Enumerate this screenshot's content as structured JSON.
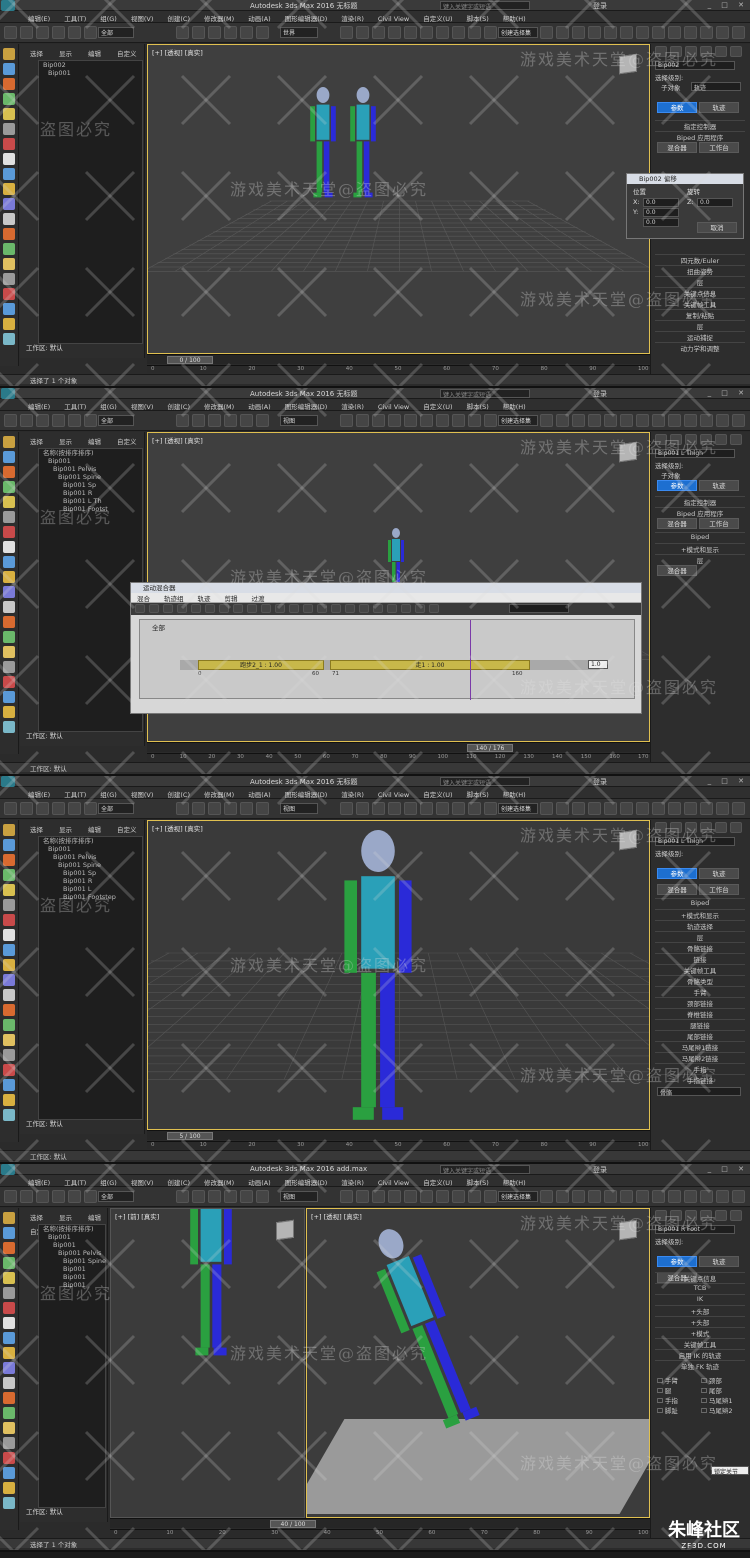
{
  "app": {
    "title": "Autodesk 3ds Max 2016",
    "search_placeholder": "键入关键字或短语",
    "login": "登录",
    "workspace_label": "工作区: 默认"
  },
  "menus": [
    "编辑(E)",
    "工具(T)",
    "组(G)",
    "视图(V)",
    "创建(C)",
    "修改器(M)",
    "动画(A)",
    "图形编辑器(D)",
    "渲染(R)",
    "Civil View",
    "自定义(U)",
    "脚本(S)",
    "帮助(H)"
  ],
  "toolbar": {
    "filter_value": "全部",
    "coord_system_1": "世界",
    "coord_system_2": "视图",
    "named_selection": "创建选择集"
  },
  "scene_explorer": {
    "tabs": [
      "选择",
      "显示",
      "编辑",
      "自定义"
    ],
    "header": "名称(按排序排序)"
  },
  "panels": [
    {
      "file": "无标题",
      "viewport_label": "[+] [透视] [真实]",
      "tree": [
        "Bip002",
        "Bip001"
      ],
      "cmd": {
        "object": "Bip002",
        "sel_level_label": "选择级别:",
        "sub_object_label": "子对象",
        "sub_object_value": "轨迹",
        "tab_params": "参数",
        "tab_track": "轨迹",
        "rollouts": [
          "指定控制器",
          "Biped 应用程序",
          "混合器",
          "工作台"
        ],
        "lower_rollouts": [
          "四元数/Euler",
          "扭曲姿势",
          "层",
          "关键点信息",
          "关键帧工具",
          "复制/粘贴",
          "层",
          "运动捕捉",
          "动力学和调整"
        ]
      },
      "floatwin": {
        "title": "Bip002 偏移",
        "pos_label": "位置",
        "rot_label": "旋转",
        "x_label": "X:",
        "y_label": "Y:",
        "z_label": "Z:",
        "x_val": "0.0",
        "y_val": "0.0",
        "z_val": "0.0",
        "rz_val": "0.0",
        "cancel": "取消"
      },
      "timeline": "0 / 100",
      "status": "选择了 1 个对象",
      "ruler": [
        "0",
        "10",
        "20",
        "30",
        "40",
        "50",
        "60",
        "70",
        "80",
        "90",
        "100"
      ]
    },
    {
      "file": "无标题",
      "viewport_label": "[+] [透视] [真实]",
      "tree": [
        "名称(按排序排序)",
        "Bip001",
        "Bip001 Pelvis",
        "Bip001 Spine",
        "Bip001 Sp",
        "Bip001 R",
        "Bip001 L Th",
        "Bip001 Footst"
      ],
      "cmd": {
        "object": "Bip001 L Thigh",
        "sel_level_label": "选择级别:",
        "sub_object_label": "子对象",
        "tab_params": "参数",
        "tab_track": "轨迹",
        "rollouts": [
          "指定控制器",
          "Biped 应用程序",
          "混合器",
          "工作台",
          "Biped",
          "+模式和显示",
          "层",
          "混合器"
        ]
      },
      "mixer": {
        "title": "运动混合器",
        "menus": [
          "混合",
          "轨迹组",
          "轨迹",
          "剪辑",
          "过渡"
        ],
        "group_label": "全部",
        "clip1": "跑步2_1 : 1.00",
        "clip2": "走1 : 1.00",
        "clip1_start": "0",
        "clip1_end": "60",
        "clip2_start": "71",
        "clip2_end": "160",
        "weight": "1.0"
      },
      "timeline": "140 / 176",
      "status": "工作区: 默认",
      "ruler": [
        "0",
        "10",
        "20",
        "30",
        "40",
        "50",
        "60",
        "70",
        "80",
        "90",
        "100",
        "110",
        "120",
        "130",
        "140",
        "150",
        "160",
        "170"
      ]
    },
    {
      "file": "无标题",
      "viewport_label": "[+] [透视] [真实]",
      "tree": [
        "名称(按排序排序)",
        "Bip001",
        "Bip001 Pelvis",
        "Bip001 Spine",
        "Bip001 Sp",
        "Bip001 R",
        "Bip001 L",
        "Bip001 Footstep"
      ],
      "cmd": {
        "object": "Bip001 L Thigh",
        "sel_level_label": "选择级别:",
        "tab_params": "参数",
        "tab_track": "轨迹",
        "rollouts": [
          "混合器",
          "工作台",
          "Biped",
          "+模式和显示",
          "轨迹选择",
          "层",
          "骨骼链接",
          "链接",
          "关键帧工具",
          "骨骼类型",
          "手臂",
          "颈部链接",
          "脊椎链接",
          "腿链接",
          "尾部链接",
          "马尾辫1链接",
          "马尾辫2链接",
          "手指",
          "手指链接"
        ],
        "dropdown": "骨骼"
      },
      "timeline": "5 / 100",
      "status": "工作区: 默认",
      "ruler": [
        "0",
        "10",
        "20",
        "30",
        "40",
        "50",
        "60",
        "70",
        "80",
        "90",
        "100"
      ]
    },
    {
      "file": "add.max",
      "viewport_left_label": "[+] [前] [真实]",
      "viewport_right_label": "[+] [透视] [真实]",
      "tree": [
        "名称(按排序排序)",
        "Bip001",
        "Bip001",
        "Bip001 Pelvis",
        "Bip001 Spine",
        "Bip001",
        "Bip001",
        "Bip001"
      ],
      "cmd": {
        "object": "Bip001 R Foot",
        "sel_level_label": "选择级别:",
        "tab_params": "参数",
        "tab_track": "轨迹",
        "rollouts": [
          "混合器",
          "关键点信息",
          "TCB",
          "IK",
          "+头部",
          "+头部",
          "+模式",
          "关键帧工具",
          "启用 IK 的轨迹",
          "单独 FK 轨迹"
        ],
        "checkbox_items": [
          "手臂",
          "颈部",
          "腿",
          "尾部",
          "手指",
          "马尾辫1",
          "脚趾",
          "马尾辫2"
        ],
        "tooltip": "锁定关节"
      },
      "timeline": "40 / 100",
      "status": "选择了 1 个对象",
      "ruler": [
        "0",
        "10",
        "20",
        "30",
        "40",
        "50",
        "60",
        "70",
        "80",
        "90",
        "100"
      ]
    }
  ],
  "watermark": {
    "text_a": "游戏美术天堂@盗图必究",
    "text_b": "盗图必究"
  },
  "footer_logo": {
    "main": "朱峰社区",
    "sub": "ZF3D.COM"
  }
}
